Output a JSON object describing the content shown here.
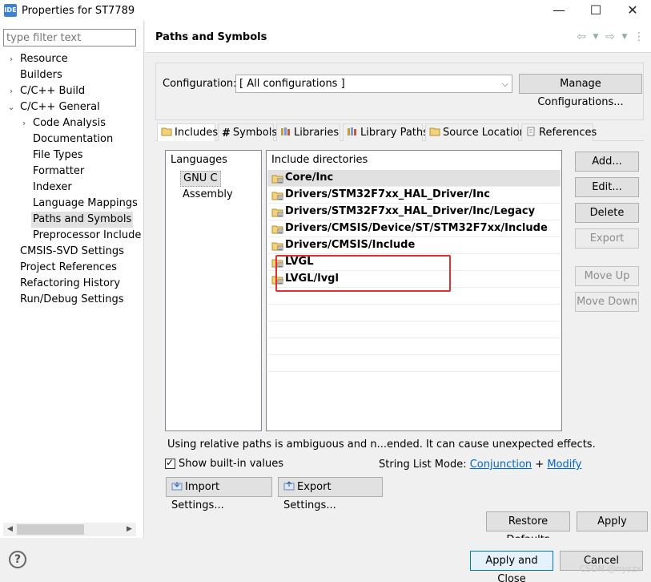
{
  "window": {
    "app_icon": "IDE",
    "title": "Properties for ST7789",
    "minimize": "—",
    "maximize": "☐",
    "close": "✕"
  },
  "left": {
    "filter_placeholder": "type filter text",
    "tree": [
      {
        "label": "Resource",
        "indent": 0,
        "chevron": "›"
      },
      {
        "label": "Builders",
        "indent": 0,
        "chevron": ""
      },
      {
        "label": "C/C++ Build",
        "indent": 0,
        "chevron": "›"
      },
      {
        "label": "C/C++ General",
        "indent": 0,
        "chevron": "⌄"
      },
      {
        "label": "Code Analysis",
        "indent": 1,
        "chevron": "›"
      },
      {
        "label": "Documentation",
        "indent": 1,
        "chevron": ""
      },
      {
        "label": "File Types",
        "indent": 1,
        "chevron": ""
      },
      {
        "label": "Formatter",
        "indent": 1,
        "chevron": ""
      },
      {
        "label": "Indexer",
        "indent": 1,
        "chevron": ""
      },
      {
        "label": "Language Mappings",
        "indent": 1,
        "chevron": ""
      },
      {
        "label": "Paths and Symbols",
        "indent": 1,
        "chevron": "",
        "selected": true
      },
      {
        "label": "Preprocessor Include",
        "indent": 1,
        "chevron": ""
      },
      {
        "label": "CMSIS-SVD Settings",
        "indent": 0,
        "chevron": ""
      },
      {
        "label": "Project References",
        "indent": 0,
        "chevron": ""
      },
      {
        "label": "Refactoring History",
        "indent": 0,
        "chevron": ""
      },
      {
        "label": "Run/Debug Settings",
        "indent": 0,
        "chevron": ""
      }
    ]
  },
  "page": {
    "title": "Paths and Symbols",
    "configuration_label": "Configuration:",
    "configuration_value": "[ All configurations ]",
    "manage_button": "Manage Configurations...",
    "tabs": [
      "Includes",
      "Symbols",
      "Libraries",
      "Library Paths",
      "Source Location",
      "References"
    ],
    "languages_header": "Languages",
    "languages": [
      "GNU C",
      "Assembly"
    ],
    "include_header": "Include directories",
    "includes": [
      "Core/Inc",
      "Drivers/STM32F7xx_HAL_Driver/Inc",
      "Drivers/STM32F7xx_HAL_Driver/Inc/Legacy",
      "Drivers/CMSIS/Device/ST/STM32F7xx/Include",
      "Drivers/CMSIS/Include",
      "LVGL",
      "LVGL/lvgl"
    ],
    "side_buttons": {
      "add": "Add...",
      "edit": "Edit...",
      "delete": "Delete",
      "export": "Export",
      "move_up": "Move Up",
      "move_down": "Move Down"
    },
    "warning": "Using relative paths is ambiguous and n...ended. It can cause unexpected effects.",
    "show_builtin": "Show built-in values",
    "string_list_mode": "String List Mode:",
    "conjunction": "Conjunction",
    "plus": "+",
    "modify": "Modify",
    "import_settings": "Import Settings...",
    "export_settings": "Export Settings...",
    "restore_defaults": "Restore Defaults",
    "apply": "Apply"
  },
  "footer": {
    "help": "?",
    "apply_and_close": "Apply and Close",
    "cancel": "Cancel",
    "watermark": "CSDN @nyszx"
  },
  "colors": {
    "highlight_border": "#e03030",
    "link": "#0066cc",
    "primary_border": "#0078d7"
  }
}
